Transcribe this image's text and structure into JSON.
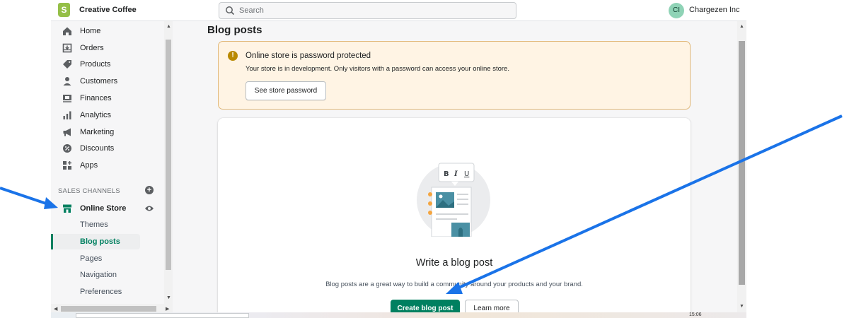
{
  "topbar": {
    "logo_letter": "S",
    "store_name": "Creative Coffee",
    "search_placeholder": "Search",
    "avatar_initials": "CI",
    "account_name": "Chargezen Inc"
  },
  "sidebar": {
    "items": [
      {
        "label": "Home",
        "icon": "home-icon"
      },
      {
        "label": "Orders",
        "icon": "orders-icon"
      },
      {
        "label": "Products",
        "icon": "tag-icon"
      },
      {
        "label": "Customers",
        "icon": "person-icon"
      },
      {
        "label": "Finances",
        "icon": "finances-icon"
      },
      {
        "label": "Analytics",
        "icon": "bar-chart-icon"
      },
      {
        "label": "Marketing",
        "icon": "megaphone-icon"
      },
      {
        "label": "Discounts",
        "icon": "discount-icon"
      },
      {
        "label": "Apps",
        "icon": "apps-icon"
      }
    ],
    "sales_channels_title": "SALES CHANNELS",
    "online_store_label": "Online Store",
    "sub_items": [
      {
        "label": "Themes"
      },
      {
        "label": "Blog posts",
        "active": true
      },
      {
        "label": "Pages"
      },
      {
        "label": "Navigation"
      },
      {
        "label": "Preferences"
      }
    ]
  },
  "main": {
    "page_title": "Blog posts",
    "banner": {
      "title": "Online store is password protected",
      "text": "Your store is in development. Only visitors with a password can access your online store.",
      "button_label": "See store password"
    },
    "empty_state": {
      "heading": "Write a blog post",
      "text": "Blog posts are a great way to build a community around your products and your brand.",
      "primary_button": "Create blog post",
      "secondary_button": "Learn more",
      "toolbar_letters": [
        "B",
        "I",
        "U"
      ]
    }
  },
  "taskbar": {
    "clock": "15:06"
  },
  "colors": {
    "accent": "#008060",
    "banner_bg": "#fff4e4",
    "banner_border": "#e1b878",
    "annotation_arrow": "#1a73e8"
  }
}
